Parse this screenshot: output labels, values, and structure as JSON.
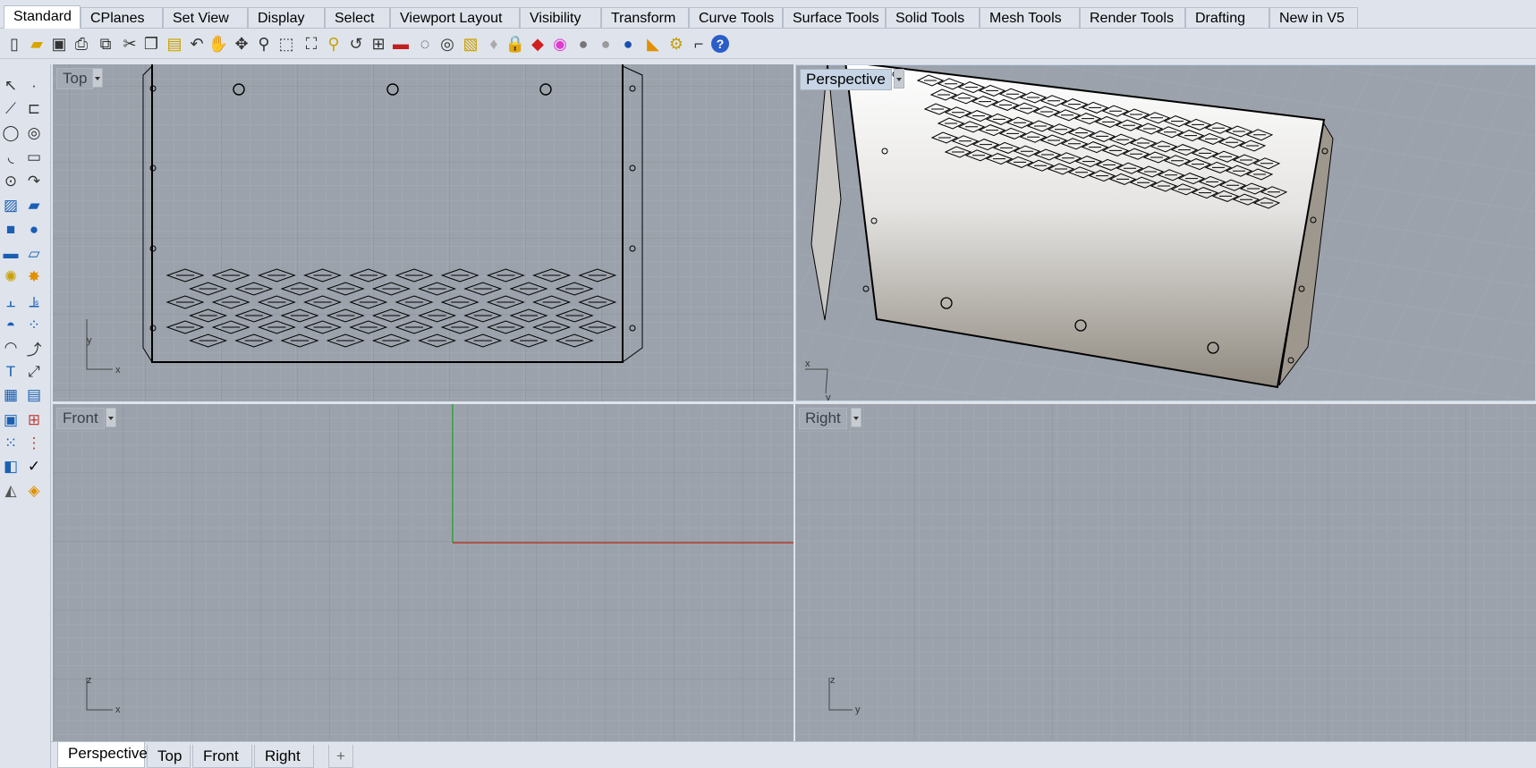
{
  "ribbon_tabs": [
    "Standard",
    "CPlanes",
    "Set View",
    "Display",
    "Select",
    "Viewport Layout",
    "Visibility",
    "Transform",
    "Curve Tools",
    "Surface Tools",
    "Solid Tools",
    "Mesh Tools",
    "Render Tools",
    "Drafting",
    "New in V5"
  ],
  "active_ribbon_tab": "Standard",
  "toolbar_icons": [
    "new-file-icon",
    "open-folder-icon",
    "save-icon",
    "print-icon",
    "import-icon",
    "cut-icon",
    "copy-icon",
    "paste-icon",
    "undo-icon",
    "pan-hand-icon",
    "rotate-view-icon",
    "zoom-icon",
    "zoom-window-icon",
    "zoom-extents-icon",
    "zoom-selected-icon",
    "undo-view-icon",
    "four-viewports-icon",
    "car-render-icon",
    "hide-objects-icon",
    "show-objects-icon",
    "object-properties-icon",
    "light-bulb-icon",
    "lock-icon",
    "layer-icon",
    "color-wheel-icon",
    "sphere-shaded-icon",
    "sphere-rendered-icon",
    "sphere-blue-icon",
    "pointer-options-icon",
    "gear-icon",
    "grasshopper-icon",
    "help-icon"
  ],
  "viewports": {
    "top": {
      "label": "Top",
      "axis_a": "y",
      "axis_b": "x"
    },
    "perspective": {
      "label": "Perspective",
      "axis_a": "x",
      "axis_b": "y"
    },
    "front": {
      "label": "Front",
      "axis_a": "z",
      "axis_b": "x"
    },
    "right": {
      "label": "Right",
      "axis_a": "z",
      "axis_b": "y"
    }
  },
  "viewport_tabs": [
    "Perspective",
    "Top",
    "Front",
    "Right"
  ],
  "active_viewport_tab": "Perspective",
  "add_tab_symbol": "+",
  "colors": {
    "viewport_bg": "#9ba2ab",
    "x_axis": "#b33a2a",
    "y_axis": "#2fa13a",
    "active_label": "#c6d4e6",
    "chrome": "#dfe4ec"
  }
}
